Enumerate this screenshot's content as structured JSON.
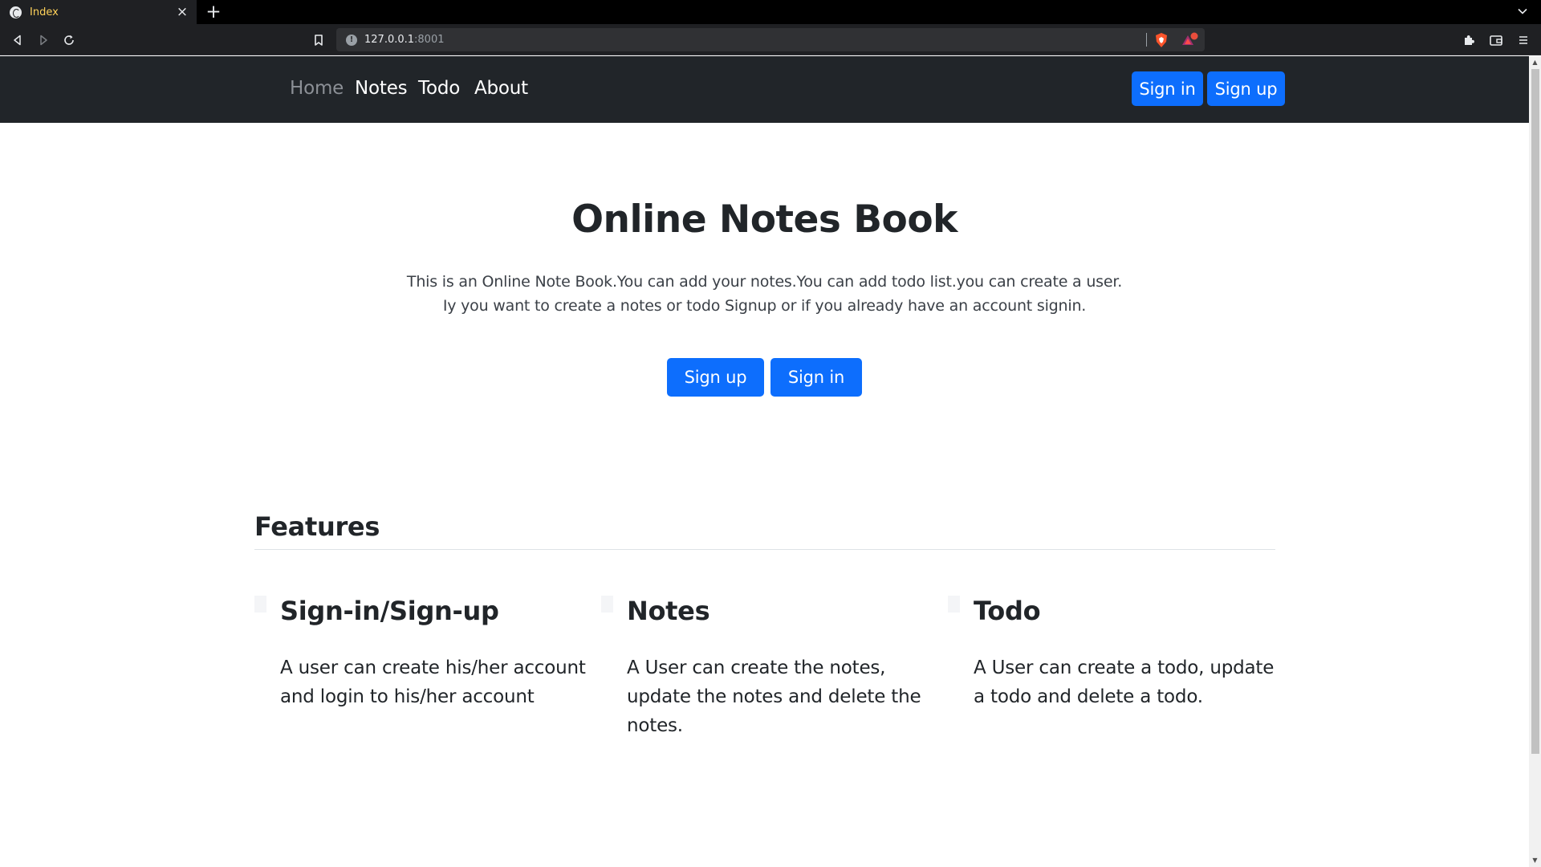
{
  "browser": {
    "tab_title": "Index",
    "tab_close": "×",
    "new_tab": "+",
    "url_host": "127.0.0.1",
    "url_port": ":8001",
    "url_info": "!"
  },
  "navbar": {
    "links": [
      {
        "label": "Home",
        "active": true
      },
      {
        "label": "Notes",
        "active": false
      },
      {
        "label": "Todo",
        "active": false
      },
      {
        "label": "About",
        "active": false
      }
    ],
    "signin_label": "Sign in",
    "signup_label": "Sign up"
  },
  "hero": {
    "title": "Online Notes Book",
    "lead_line1": "This is an Online Note Book.You can add your notes.You can add todo list.you can create a user.",
    "lead_line2": "Iy you want to create a notes or todo Signup or if you already have an account signin.",
    "signup_label": "Sign up",
    "signin_label": "Sign in"
  },
  "features": {
    "heading": "Features",
    "items": [
      {
        "title": "Sign-in/Sign-up",
        "text": "A user can create his/her account and login to his/her account"
      },
      {
        "title": "Notes",
        "text": "A User can create the notes, update the notes and delete the notes."
      },
      {
        "title": "Todo",
        "text": "A User can create a todo, update a todo and delete a todo."
      }
    ]
  },
  "colors": {
    "primary": "#0d6efd",
    "navbar_bg": "#212529",
    "nav_active": "#8c9096",
    "text": "#212529"
  },
  "icons": {
    "back": "back-icon",
    "forward": "forward-icon",
    "reload": "reload-icon",
    "bookmark": "bookmark-icon",
    "brave_shield": "brave-shield-icon",
    "brave_rewards": "brave-rewards-icon",
    "extensions": "extensions-icon",
    "wallet": "wallet-icon",
    "menu": "menu-icon"
  }
}
